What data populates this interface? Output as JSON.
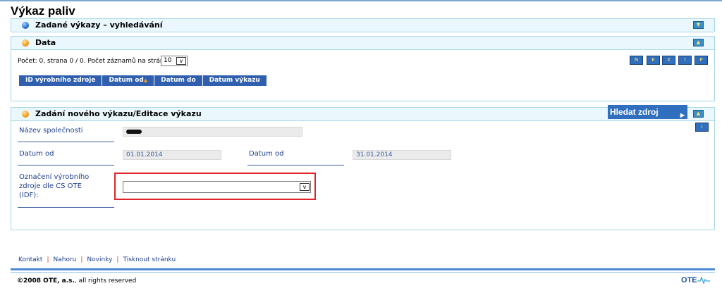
{
  "page": {
    "title": "Výkaz paliv"
  },
  "panel_search": {
    "title": "Zadané výkazy – vyhledávání"
  },
  "panel_data": {
    "title": "Data",
    "count_text": "Počet: 0, strana 0 / 0. Počet záznamů na stránku",
    "per_page": "10",
    "columns": [
      "ID výrobního zdroje",
      "Datum od",
      "Datum do",
      "Datum výkazu"
    ],
    "toolbar_icons": [
      "new-record-icon",
      "edit-icon",
      "export-icon",
      "import-icon",
      "print-icon"
    ]
  },
  "panel_edit": {
    "title": "Zadání nového výkazu/Editace výkazu",
    "company_label": "Název společnosti",
    "date_from_label": "Datum od",
    "date_from_value": "01.01.2014",
    "date_to_label": "Datum od",
    "date_to_value": "31.01.2014",
    "idf_label_line1": "Označení výrobního",
    "idf_label_line2": "zdroje dle CS OTE",
    "idf_label_line3": "(IDF):",
    "idf_value": "",
    "search_button": "Hledat zdroj"
  },
  "footer": {
    "links": [
      "Kontakt",
      "Nahoru",
      "Novinky",
      "Tisknout stránku"
    ],
    "copyright_bold": "©2008 OTE, a.s.",
    "copyright_rest": ", all rights reserved",
    "logo": "OTE"
  },
  "colors": {
    "accent": "#2f6fbd",
    "panel_border": "#a9d7e8",
    "highlight": "#e0242a"
  }
}
